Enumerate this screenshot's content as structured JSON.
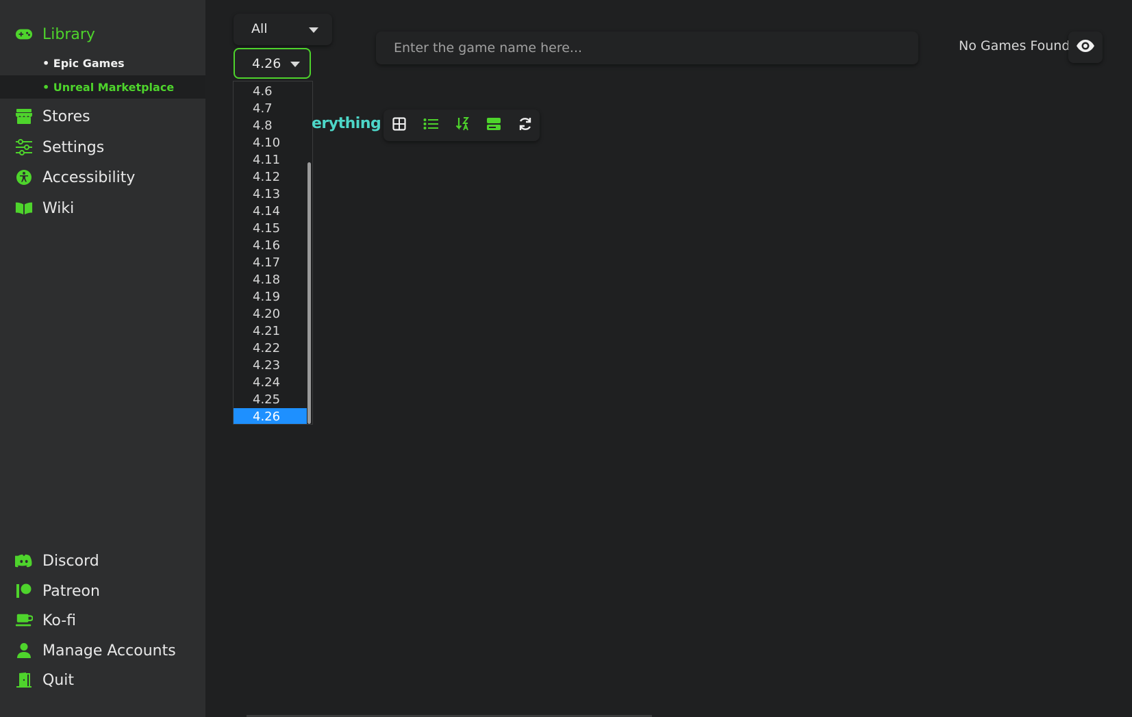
{
  "sidebar": {
    "library": "Library",
    "library_subitems": [
      "• Epic Games",
      "• Unreal Marketplace"
    ],
    "stores": "Stores",
    "settings": "Settings",
    "accessibility": "Accessibility",
    "wiki": "Wiki",
    "discord": "Discord",
    "patreon": "Patreon",
    "kofi": "Ko-fi",
    "manage_accounts": "Manage Accounts",
    "quit": "Quit"
  },
  "filters": {
    "category_selected": "All",
    "version_selected": "4.26",
    "version_options": [
      "4.6",
      "4.7",
      "4.8",
      "4.10",
      "4.11",
      "4.12",
      "4.13",
      "4.14",
      "4.15",
      "4.16",
      "4.17",
      "4.18",
      "4.19",
      "4.20",
      "4.21",
      "4.22",
      "4.23",
      "4.24",
      "4.25",
      "4.26"
    ]
  },
  "search": {
    "placeholder": "Enter the game name here..."
  },
  "status": {
    "no_games": "No Games Found"
  },
  "heading": {
    "fragment": "erything"
  },
  "toolbar": {
    "icons": [
      "grid-view-icon",
      "list-view-icon",
      "sort-icon",
      "storage-icon",
      "refresh-icon"
    ]
  },
  "colors": {
    "accent": "#4ed42c",
    "heading": "#4dd6c8",
    "selected_option": "#1e90ff",
    "sidebar_bg": "#2d2e2f",
    "main_bg": "#1f2021"
  }
}
